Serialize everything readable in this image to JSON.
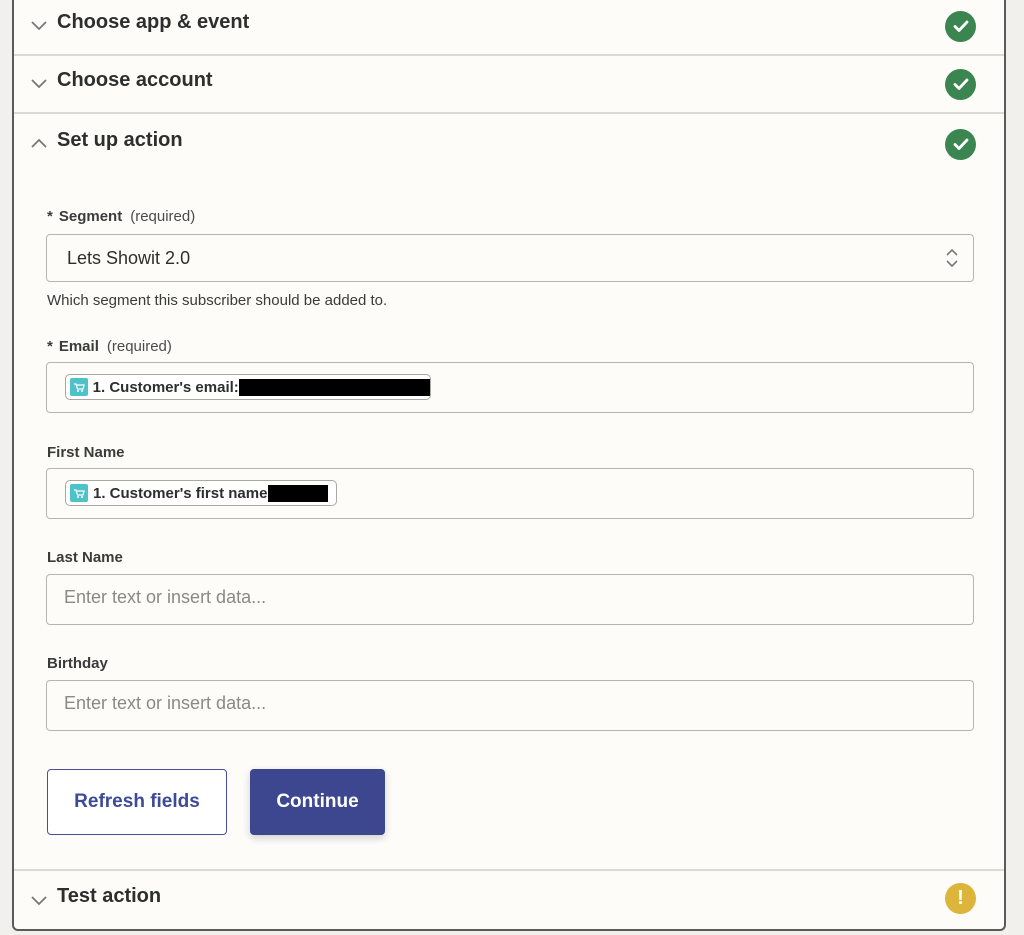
{
  "sections": [
    {
      "title": "Choose app & event",
      "state": "collapsed",
      "status": "complete"
    },
    {
      "title": "Choose account",
      "state": "collapsed",
      "status": "complete"
    },
    {
      "title": "Set up action",
      "state": "expanded",
      "status": "complete"
    },
    {
      "title": "Test action",
      "state": "collapsed",
      "status": "warning"
    }
  ],
  "status_icons": {
    "complete": "check-circle-icon",
    "warning": "exclamation-circle-icon"
  },
  "colors": {
    "complete": "#3b8550",
    "warning": "#dcb53a",
    "primary": "#3d4790"
  },
  "form": {
    "segment": {
      "star": "*",
      "label": "Segment",
      "required": "(required)",
      "value": "Lets Showit 2.0",
      "help": "Which segment this subscriber should be added to."
    },
    "email": {
      "star": "*",
      "label": "Email",
      "required": "(required)",
      "pill_text": "1. Customer's email:",
      "pill_icon": "shopping-cart-app-icon"
    },
    "first_name": {
      "label": "First Name",
      "pill_text": "1. Customer's first name:",
      "pill_icon": "shopping-cart-app-icon"
    },
    "last_name": {
      "label": "Last Name",
      "placeholder": "Enter text or insert data..."
    },
    "birthday": {
      "label": "Birthday",
      "placeholder": "Enter text or insert data..."
    }
  },
  "buttons": {
    "refresh": "Refresh fields",
    "continue": "Continue"
  },
  "warning_glyph": "!"
}
